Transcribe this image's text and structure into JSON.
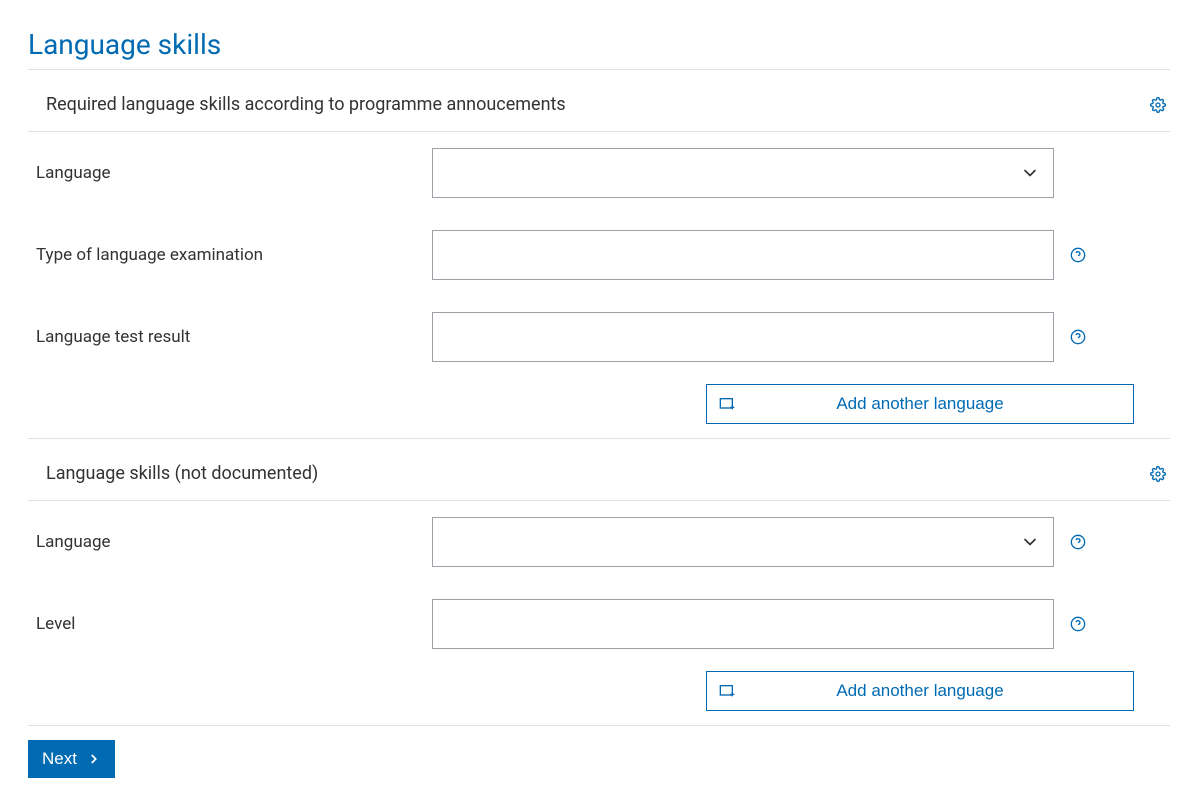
{
  "page": {
    "title": "Language skills"
  },
  "sections": {
    "required": {
      "title": "Required language skills according to programme annoucements",
      "fields": {
        "language": {
          "label": "Language",
          "value": ""
        },
        "exam_type": {
          "label": "Type of language examination",
          "value": ""
        },
        "test_result": {
          "label": "Language test result",
          "value": ""
        }
      },
      "add_button": "Add another language"
    },
    "undocumented": {
      "title": "Language skills (not documented)",
      "fields": {
        "language": {
          "label": "Language",
          "value": ""
        },
        "level": {
          "label": "Level",
          "value": ""
        }
      },
      "add_button": "Add another language"
    }
  },
  "buttons": {
    "next": "Next"
  }
}
